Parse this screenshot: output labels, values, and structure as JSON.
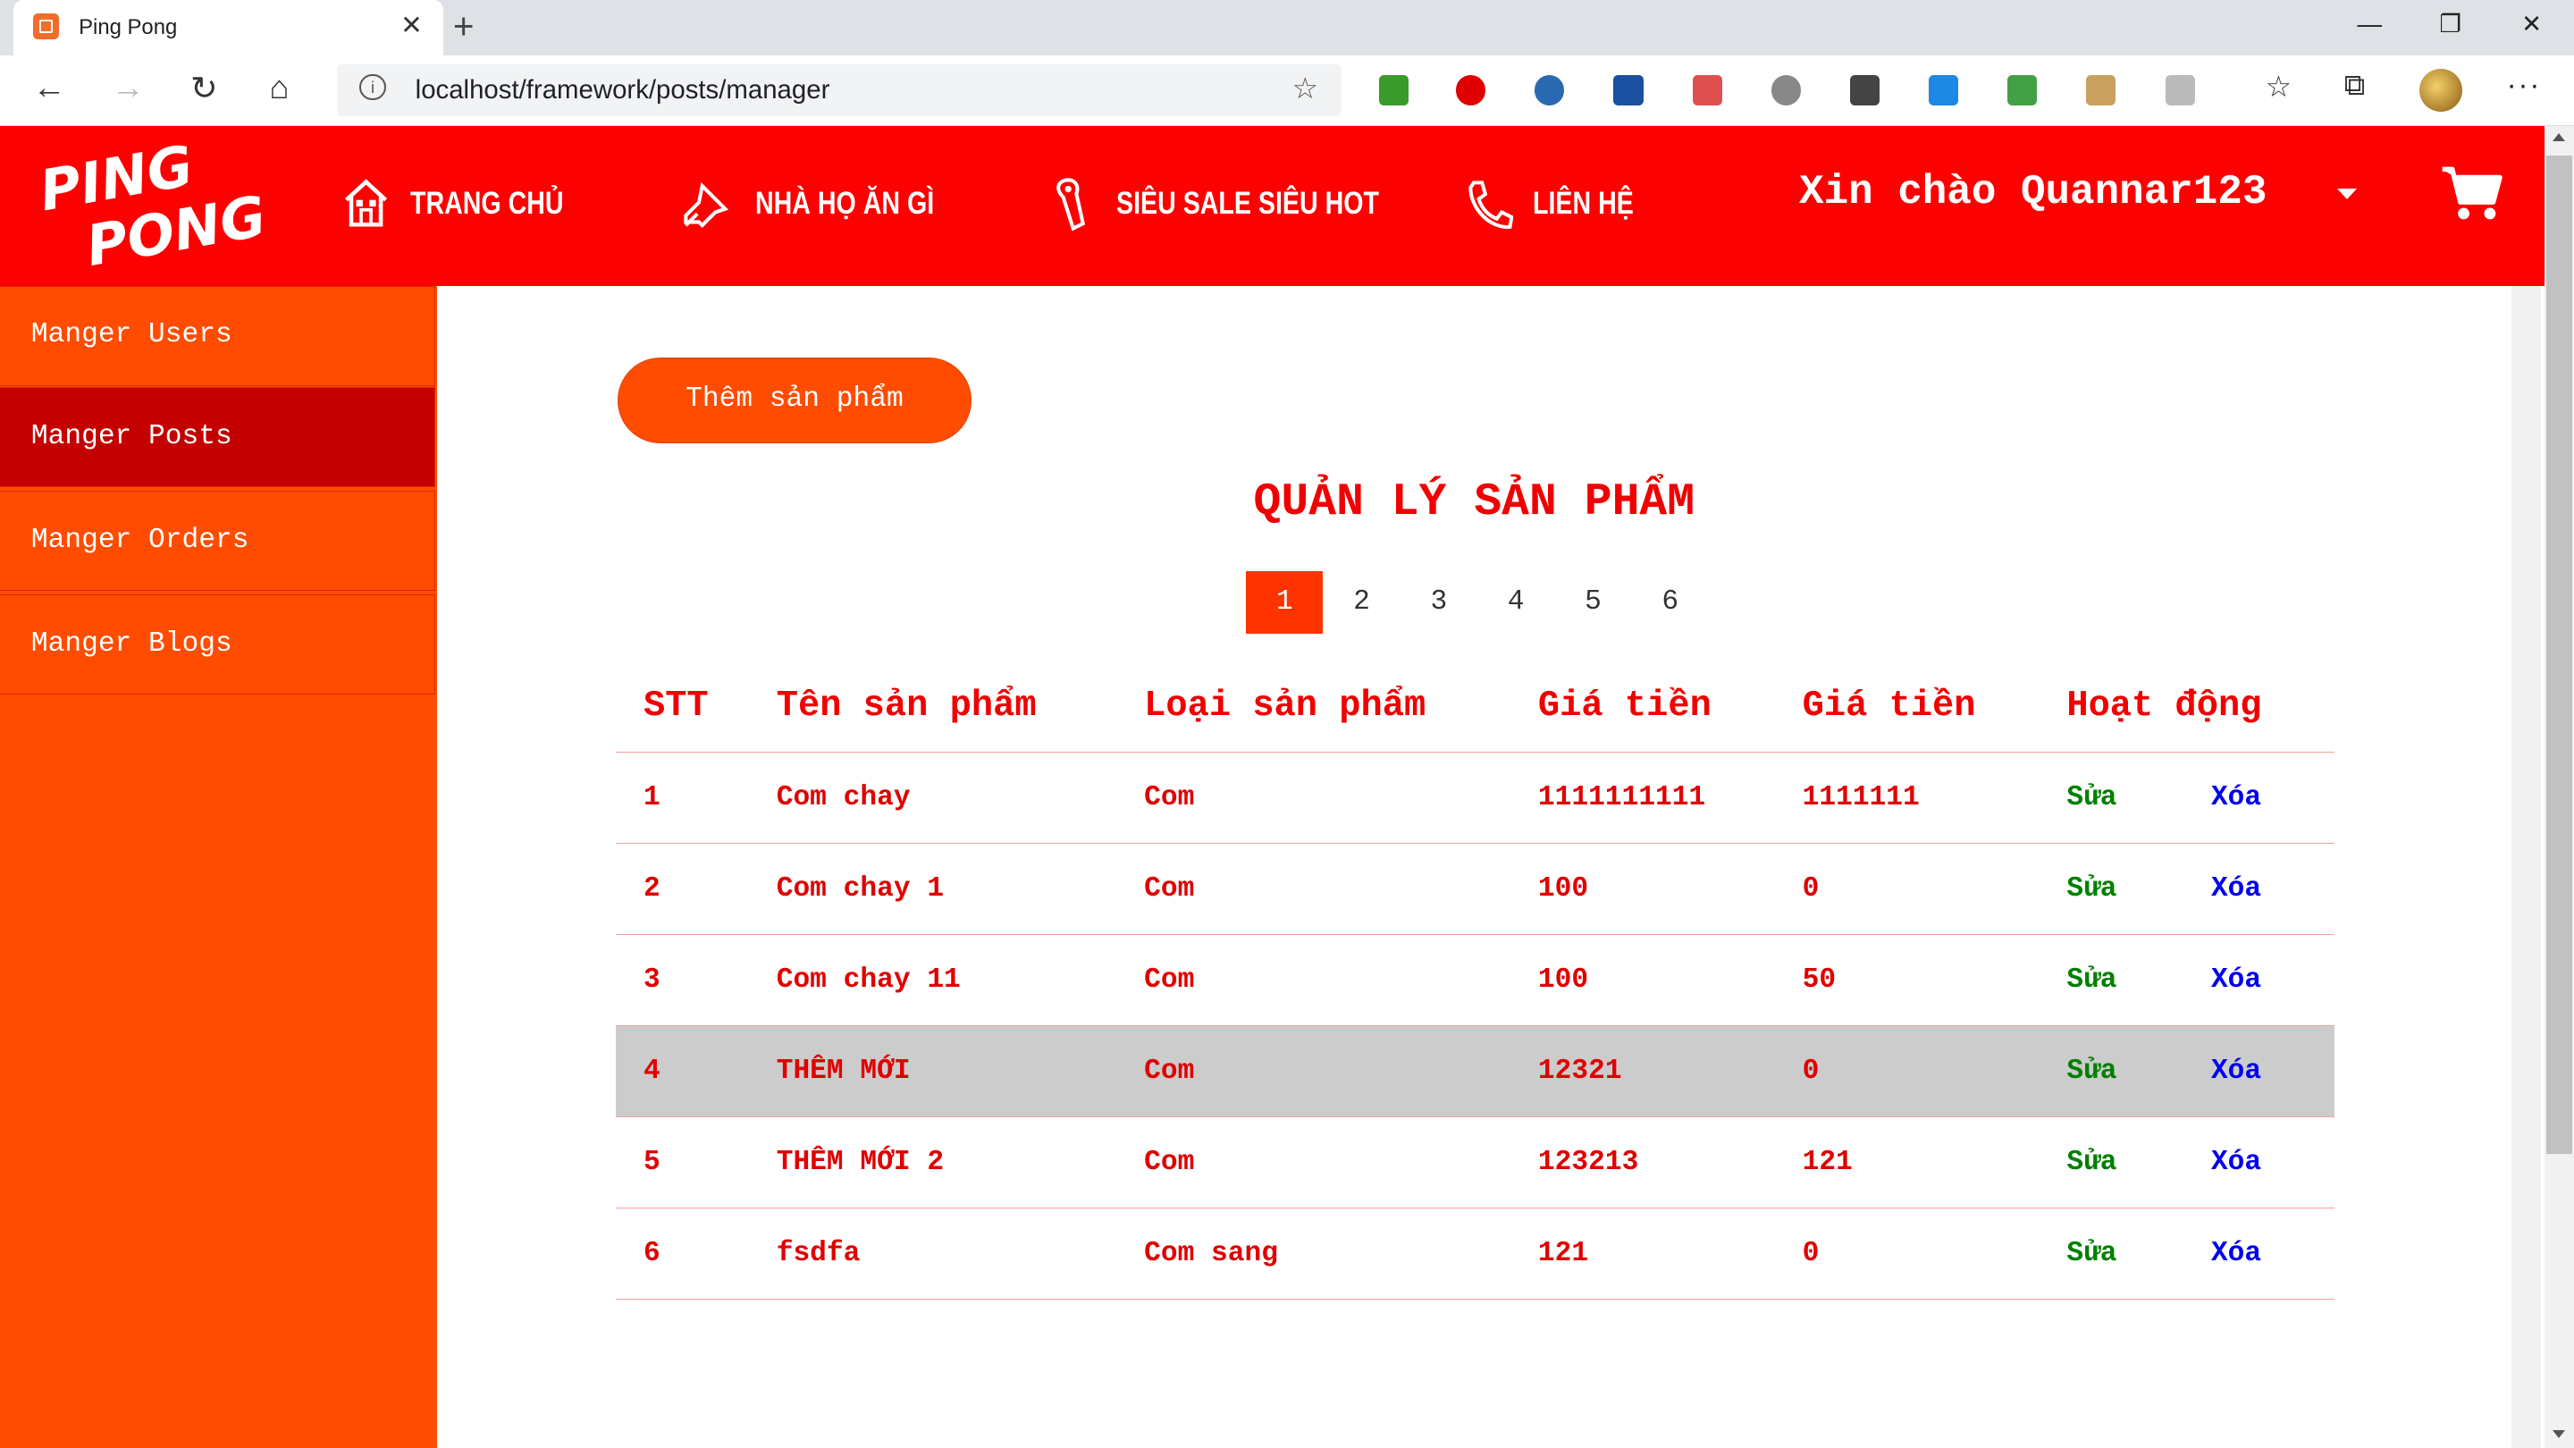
{
  "browser": {
    "tab_title": "Ping Pong",
    "url": "localhost/framework/posts/manager"
  },
  "header": {
    "logo_line1": "PING",
    "logo_line2": "PONG",
    "nav": [
      {
        "label": "TRANG CHỦ",
        "icon": "home-icon"
      },
      {
        "label": "NHÀ HỌ ĂN GÌ",
        "icon": "pin-icon"
      },
      {
        "label": "SIÊU SALE SIÊU HOT",
        "icon": "tag-icon"
      },
      {
        "label": "LIÊN HỆ",
        "icon": "phone-icon"
      }
    ],
    "greeting": "Xin chào Quannar123",
    "cart_icon": "cart-icon"
  },
  "sidebar": {
    "items": [
      {
        "label": "Manger Users"
      },
      {
        "label": "Manger Posts",
        "active": true
      },
      {
        "label": "Manger Orders"
      },
      {
        "label": "Manger Blogs"
      }
    ]
  },
  "main": {
    "add_button": "Thêm sản phẩm",
    "title": "QUẢN LÝ SẢN PHẨM",
    "pages": [
      "1",
      "2",
      "3",
      "4",
      "5",
      "6"
    ],
    "current_page": "1",
    "columns": [
      "STT",
      "Tên sản phẩm",
      "Loại sản phẩm",
      "Giá tiền",
      "Giá tiền",
      "Hoạt động"
    ],
    "rows": [
      {
        "stt": "1",
        "name": "Com chay",
        "type": "Com",
        "price": "1111111111",
        "price2": "1111111",
        "edit": "Sửa",
        "delete": "Xóa"
      },
      {
        "stt": "2",
        "name": "Com chay 1",
        "type": "Com",
        "price": "100",
        "price2": "0",
        "edit": "Sửa",
        "delete": "Xóa"
      },
      {
        "stt": "3",
        "name": "Com chay 11",
        "type": "Com",
        "price": "100",
        "price2": "50",
        "edit": "Sửa",
        "delete": "Xóa"
      },
      {
        "stt": "4",
        "name": "THÊM MỚI",
        "type": "Com",
        "price": "12321",
        "price2": "0",
        "edit": "Sửa",
        "delete": "Xóa"
      },
      {
        "stt": "5",
        "name": "THÊM MỚI 2",
        "type": "Com",
        "price": "123213",
        "price2": "121",
        "edit": "Sửa",
        "delete": "Xóa"
      },
      {
        "stt": "6",
        "name": "fsdfa",
        "type": "Com sang",
        "price": "121",
        "price2": "0",
        "edit": "Sửa",
        "delete": "Xóa"
      }
    ]
  },
  "colors": {
    "header_red": "#fd0000",
    "sidebar_orange": "#ff4c00",
    "active_item": "#c40000",
    "edit_green": "#008000",
    "delete_blue": "#0000ee",
    "highlight_row": "#cccccc"
  }
}
